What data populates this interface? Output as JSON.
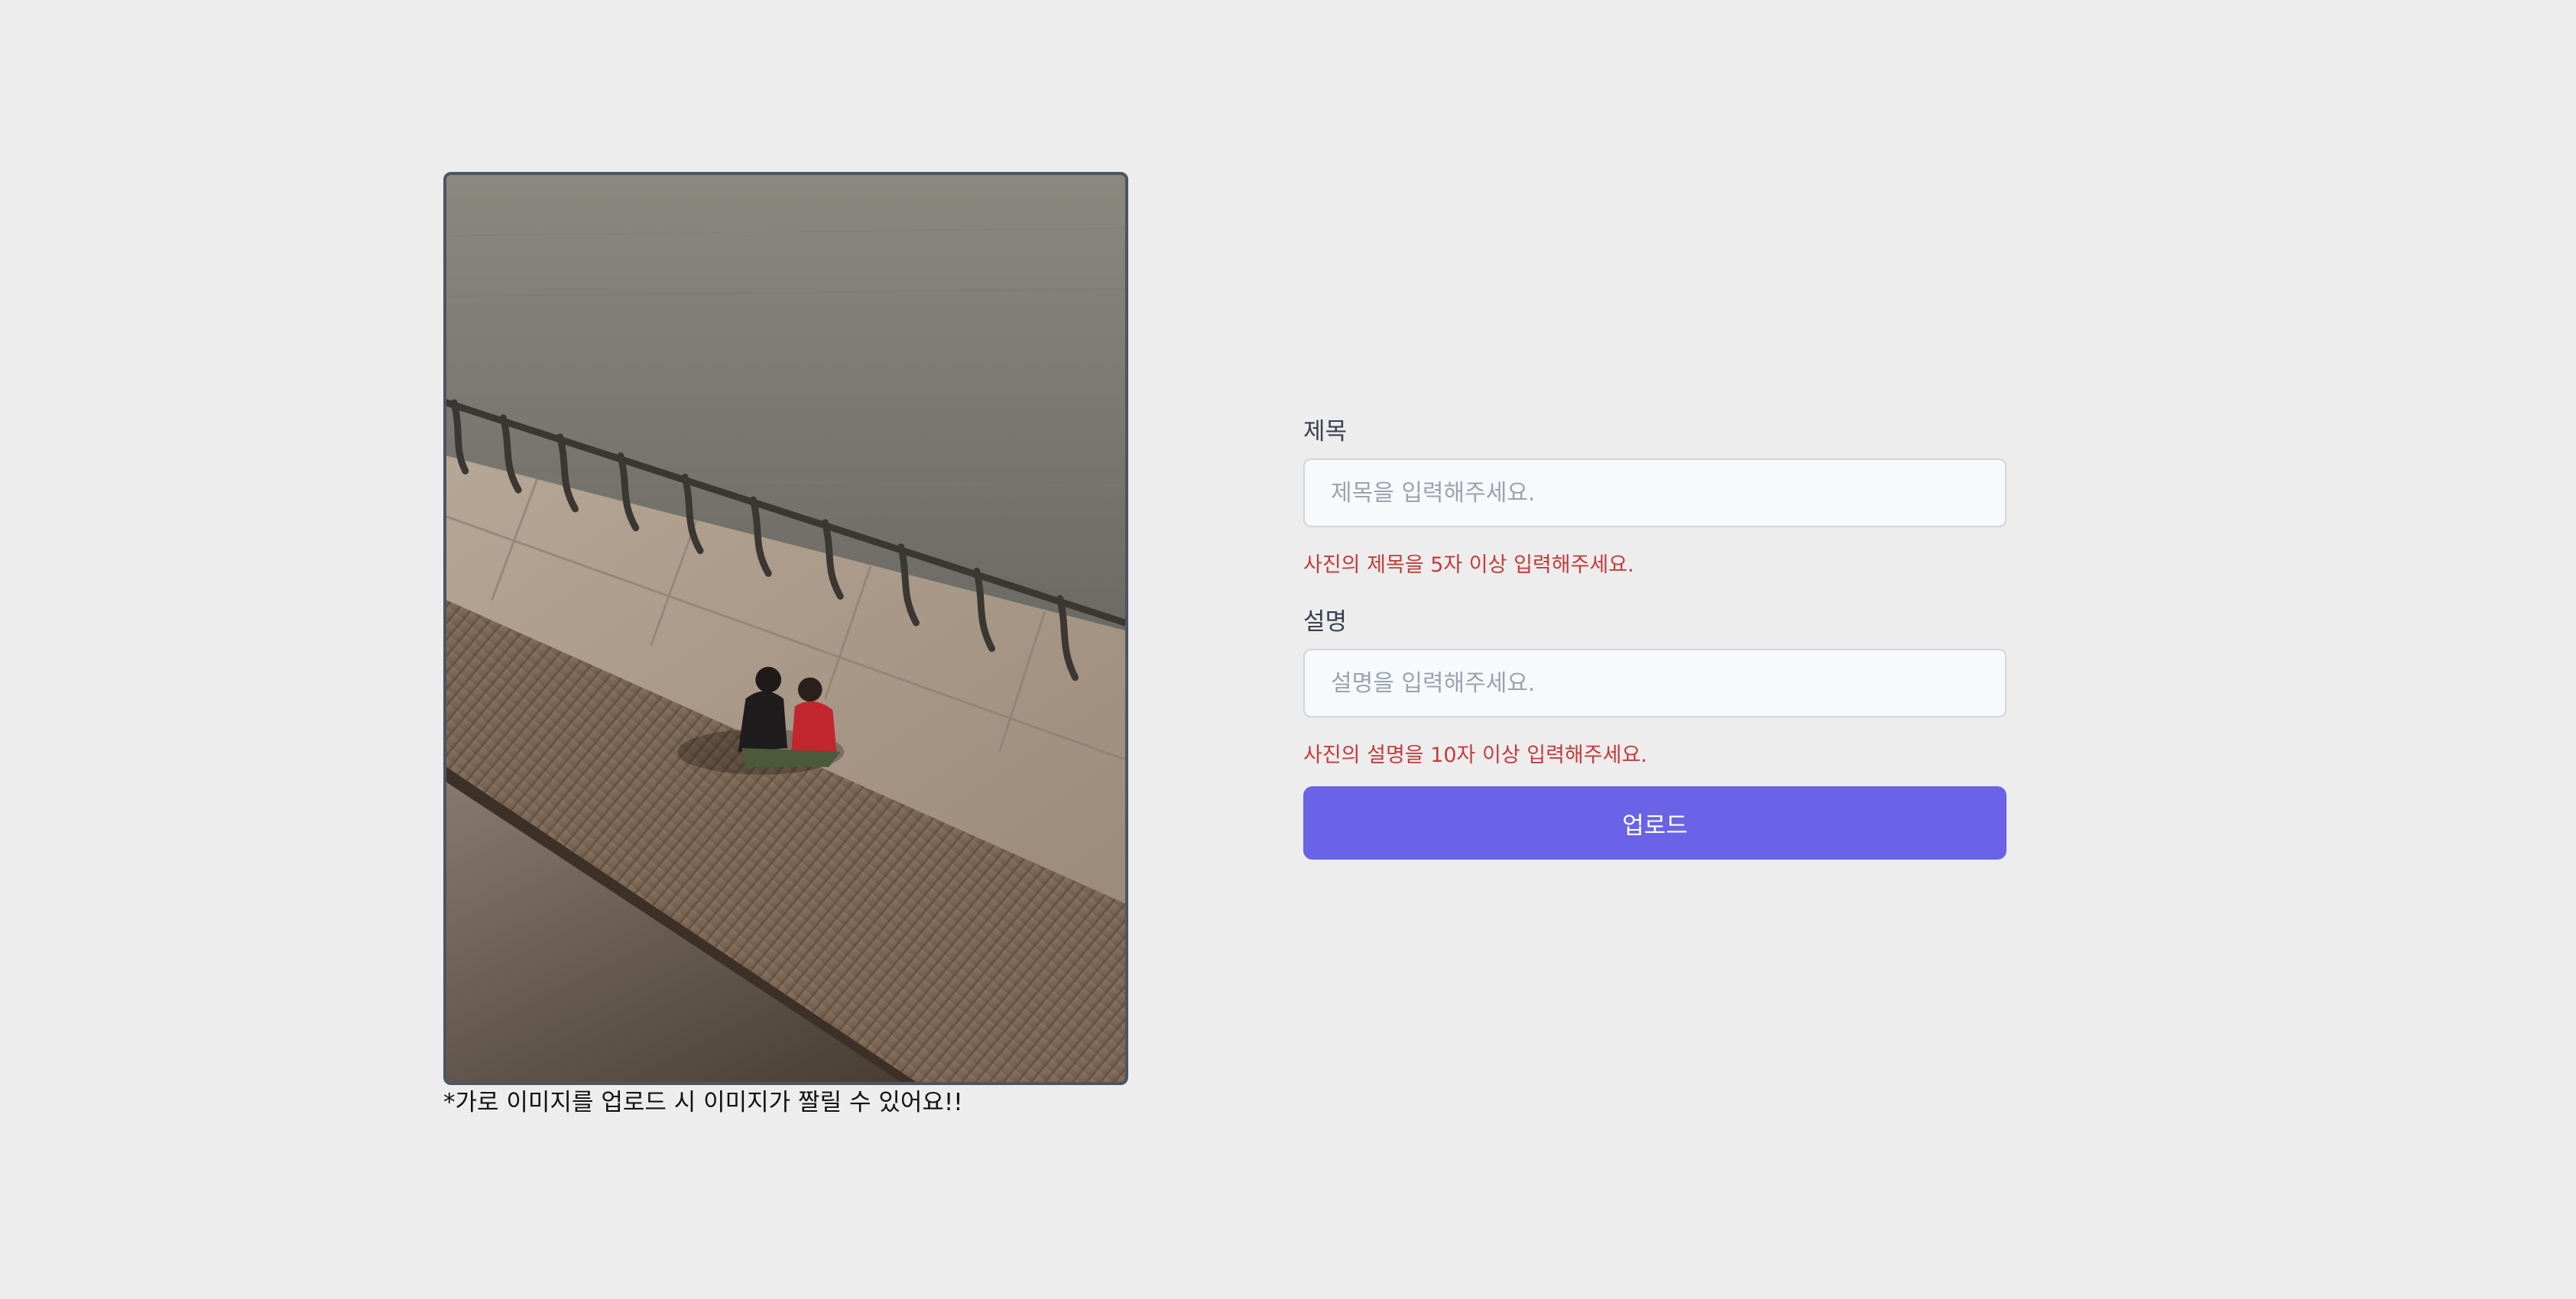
{
  "preview": {
    "caption": "*가로 이미지를 업로드 시 이미지가 짤릴 수 있어요!!"
  },
  "form": {
    "title": {
      "label": "제목",
      "placeholder": "제목을 입력해주세요.",
      "error": "사진의 제목을 5자 이상 입력해주세요."
    },
    "description": {
      "label": "설명",
      "placeholder": "설명을 입력해주세요.",
      "error": "사진의 설명을 10자 이상 입력해주세요."
    },
    "submit_label": "업로드"
  },
  "colors": {
    "background": "#ededed",
    "accent": "#6a63e8",
    "error": "#c53b3b",
    "frame_border": "#4b5563"
  }
}
